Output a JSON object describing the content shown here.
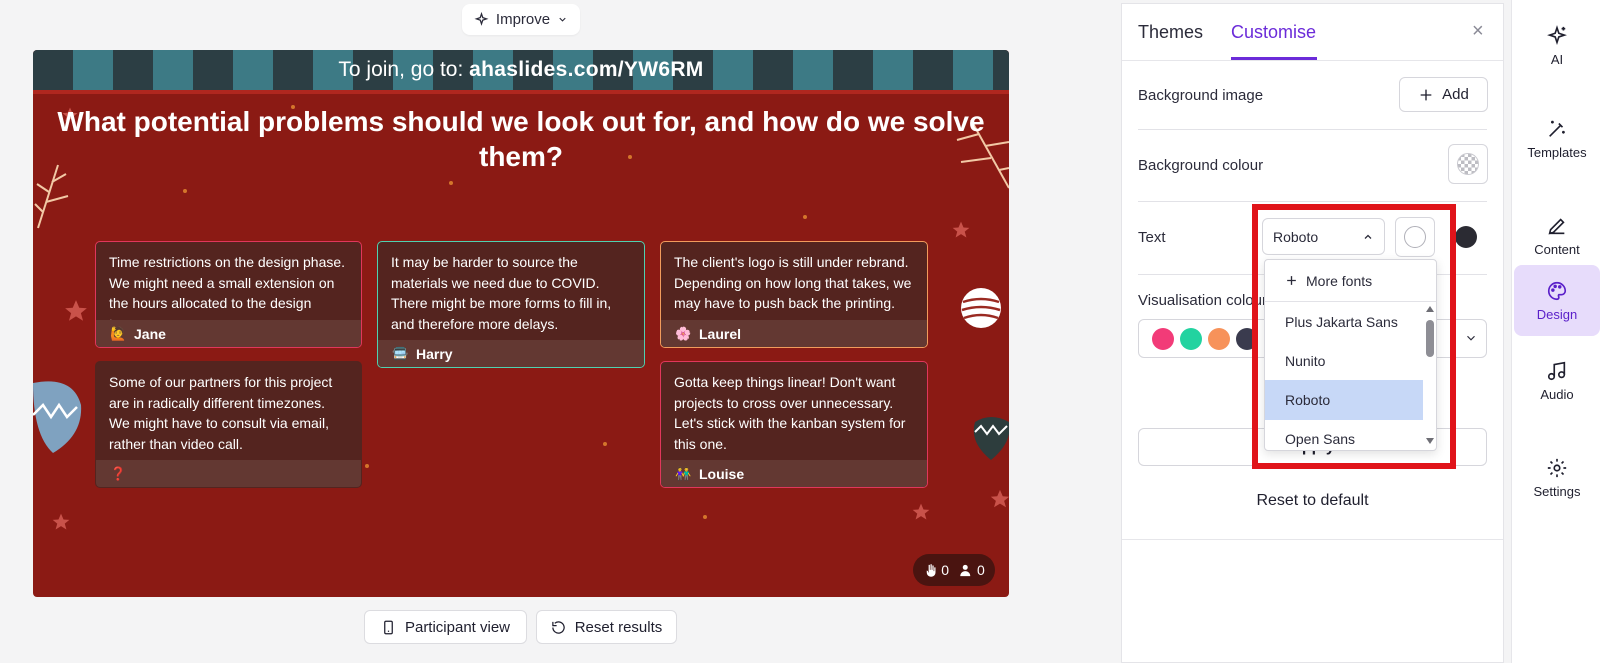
{
  "toolbar": {
    "improve_label": "Improve"
  },
  "slide": {
    "join_prefix": "To join, go to: ",
    "join_url": "ahaslides.com/YW6RM",
    "question": "What potential problems should we look out for, and how do we solve them?",
    "cards": [
      {
        "text": "Time restrictions on the design phase. We might need a small extension on the hours allocated to the design team.",
        "author": "Jane",
        "emoji": "🙋",
        "border": "#e0375b"
      },
      {
        "text": "It may be harder to source the materials we need due to COVID. There might be more forms to fill in, and therefore more delays.",
        "author": "Harry",
        "emoji": "🚍",
        "border": "#4fd1b0"
      },
      {
        "text": "The client's logo is still under rebrand. Depending on how long that takes, we may have to push back the printing.",
        "author": "Laurel",
        "emoji": "🌸",
        "border": "#f29b5c"
      },
      {
        "text": "Some of our partners for this project are in radically different timezones. We might have to consult via email, rather than video call.",
        "author": "",
        "emoji": "❓",
        "border": "#54241f"
      },
      {
        "text": "Gotta keep things linear! Don't want projects to cross over unnecessary. Let's stick with the kanban system for this one.",
        "author": "Louise",
        "emoji": "👫",
        "border": "#e0375b"
      }
    ],
    "reactions_count": "0",
    "participants_count": "0"
  },
  "bottom": {
    "participant_view": "Participant view",
    "reset_results": "Reset results"
  },
  "panel": {
    "tabs": {
      "themes": "Themes",
      "customise": "Customise"
    },
    "close": "×",
    "background_image_label": "Background image",
    "add_label": "Add",
    "background_colour_label": "Background colour",
    "text_label": "Text",
    "font_value": "Roboto",
    "visualisation_label": "Visualisation colour",
    "viz_colors": [
      "#f23b78",
      "#22d3a0",
      "#f7925a",
      "#3a3b4e"
    ],
    "text_colors": [
      "#ffffff",
      "#2b2b33"
    ],
    "apply_label": "Apply",
    "reset_default": "Reset to default"
  },
  "font_dropdown": {
    "more_fonts": "More fonts",
    "options": [
      "Plus Jakarta Sans",
      "Nunito",
      "Roboto",
      "Open Sans"
    ],
    "selected": "Roboto"
  },
  "rail": {
    "items": [
      {
        "label": "AI",
        "icon": "sparkle-icon"
      },
      {
        "label": "Templates",
        "icon": "magic-wand-icon"
      },
      {
        "label": "Content",
        "icon": "pencil-icon"
      },
      {
        "label": "Design",
        "icon": "palette-icon"
      },
      {
        "label": "Audio",
        "icon": "music-note-icon"
      },
      {
        "label": "Settings",
        "icon": "gear-icon"
      }
    ],
    "active": "Design"
  }
}
